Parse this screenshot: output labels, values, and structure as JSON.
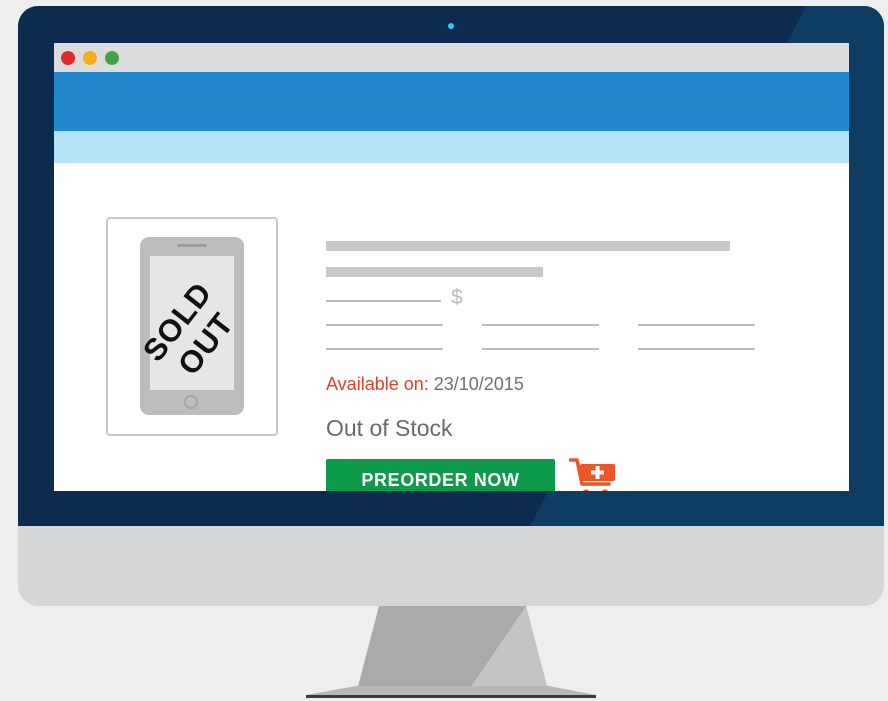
{
  "window": {
    "controls": [
      "close",
      "minimize",
      "maximize"
    ]
  },
  "product": {
    "badge": "SOLD OUT",
    "currency_symbol": "$",
    "availability_label": "Available on:",
    "availability_date": "23/10/2015",
    "stock_status": "Out of Stock",
    "preorder_label": "PREORDER NOW",
    "image_icon": "smartphone-icon",
    "cart_icon": "add-to-cart-icon"
  },
  "colors": {
    "nav_bar": "#2389cf",
    "subnav_bar": "#b7e3f8",
    "preorder_button": "#0e9a4b",
    "cart_icon": "#e8562a",
    "availability_label": "#e2402f",
    "bezel": "#0b2b4f"
  }
}
